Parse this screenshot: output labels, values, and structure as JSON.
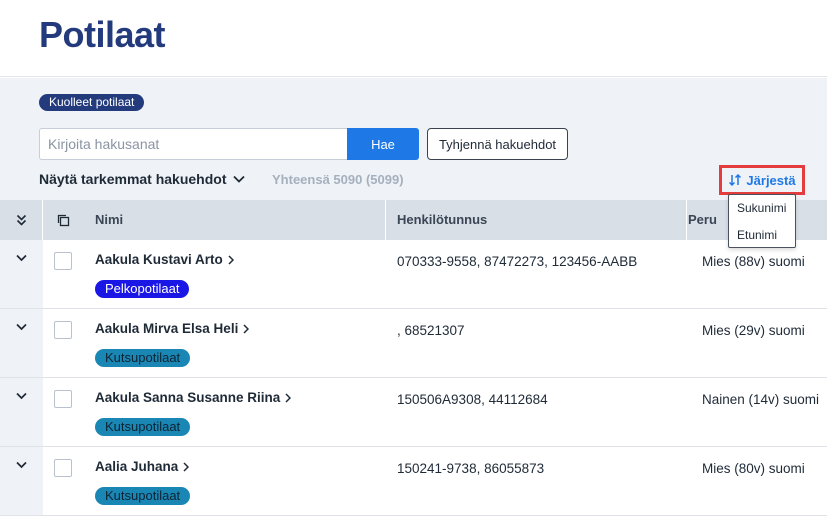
{
  "page": {
    "title": "Potilaat"
  },
  "filters": {
    "deceased_chip": "Kuolleet potilaat",
    "search_placeholder": "Kirjoita hakusanat",
    "search_button": "Hae",
    "clear_button": "Tyhjennä hakuehdot",
    "advanced_toggle": "Näytä tarkemmat hakuehdot",
    "total": "Yhteensä 5090 (5099)"
  },
  "sort": {
    "label": "Järjestä",
    "options": [
      "Sukunimi",
      "Etunimi"
    ]
  },
  "table": {
    "columns": {
      "name": "Nimi",
      "ssn": "Henkilötunnus",
      "basic": "Peru"
    },
    "rows": [
      {
        "name": "Aakula Kustavi Arto",
        "badge": "Pelkopotilaat",
        "ssn": "070333-9558, 87472273, 123456-AABB",
        "basic": "Mies (88v) suomi"
      },
      {
        "name": "Aakula Mirva Elsa Heli",
        "badge": "Kutsupotilaat",
        "ssn": ", 68521307",
        "basic": "Mies (29v) suomi"
      },
      {
        "name": "Aakula Sanna Susanne Riina",
        "badge": "Kutsupotilaat",
        "ssn": "150506A9308, 44112684",
        "basic": "Nainen (14v) suomi"
      },
      {
        "name": "Aalia Juhana",
        "badge": "Kutsupotilaat",
        "ssn": "150241-9738, 86055873",
        "basic": "Mies (80v) suomi"
      }
    ]
  },
  "colors": {
    "title": "#233a7c",
    "primary": "#1e78e6",
    "highlight": "#e53d3d",
    "badge_pelko": "#1a16e6",
    "badge_kutsu": "#1a86b3"
  }
}
